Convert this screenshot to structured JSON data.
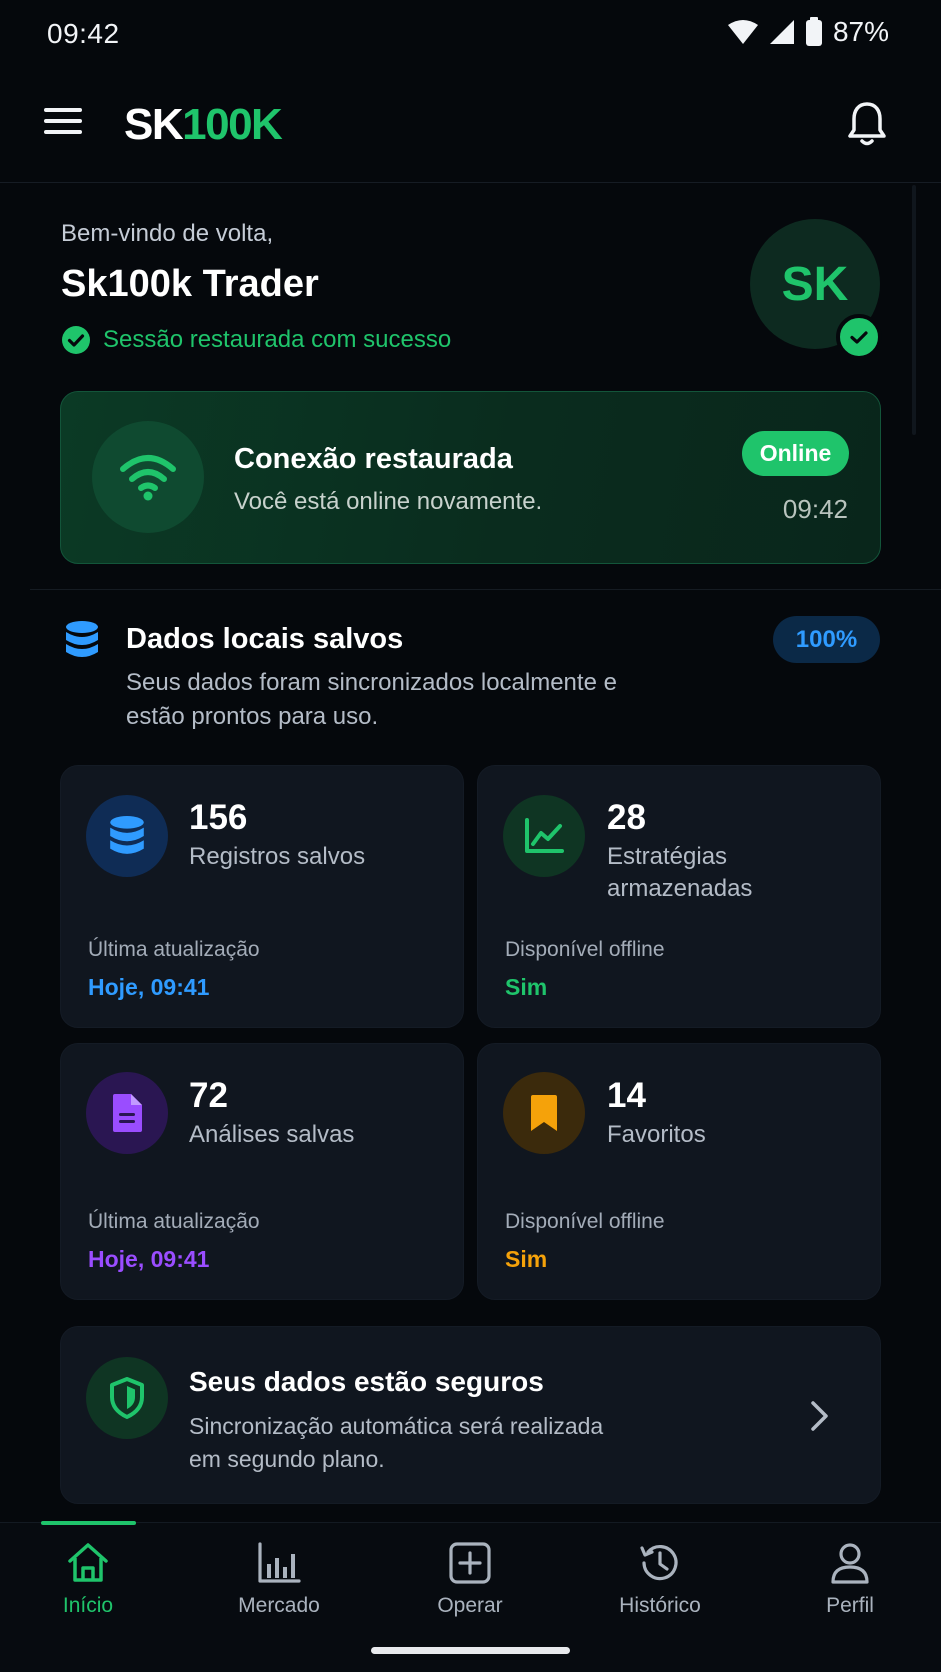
{
  "status_bar": {
    "time": "09:42",
    "battery": "87%"
  },
  "app_bar": {
    "logo_part1": "SK",
    "logo_part2": "100K"
  },
  "welcome": {
    "greeting": "Bem-vindo de volta,",
    "name": "Sk100k Trader",
    "session_status": "Sessão restaurada com sucesso",
    "avatar_initials": "SK"
  },
  "connection": {
    "title": "Conexão restaurada",
    "subtitle": "Você está online novamente.",
    "badge": "Online",
    "time": "09:42"
  },
  "local_data": {
    "title": "Dados locais salvos",
    "description": "Seus dados foram sincronizados localmente e estão prontos para uso.",
    "percent": "100%"
  },
  "stats": [
    {
      "value": "156",
      "label": "Registros salvos",
      "foot_label": "Última atualização",
      "foot_value": "Hoje, 09:41",
      "icon": "database-icon",
      "accent": "#2f9bff"
    },
    {
      "value": "28",
      "label": "Estratégias armazenadas",
      "foot_label": "Disponível offline",
      "foot_value": "Sim",
      "icon": "chart-line-icon",
      "accent": "#1fc46b"
    },
    {
      "value": "72",
      "label": "Análises salvas",
      "foot_label": "Última atualização",
      "foot_value": "Hoje, 09:41",
      "icon": "document-icon",
      "accent": "#9a4dff"
    },
    {
      "value": "14",
      "label": "Favoritos",
      "foot_label": "Disponível offline",
      "foot_value": "Sim",
      "icon": "bookmark-icon",
      "accent": "#f5a20a"
    }
  ],
  "secure": {
    "title": "Seus dados estão seguros",
    "description": "Sincronização automática será realizada em segundo plano."
  },
  "bottom_nav": [
    {
      "label": "Início",
      "icon": "home-icon",
      "active": true
    },
    {
      "label": "Mercado",
      "icon": "market-chart-icon",
      "active": false
    },
    {
      "label": "Operar",
      "icon": "plus-square-icon",
      "active": false
    },
    {
      "label": "Histórico",
      "icon": "history-clock-icon",
      "active": false
    },
    {
      "label": "Perfil",
      "icon": "profile-icon",
      "active": false
    }
  ],
  "colors": {
    "background": "#05080c",
    "accent_green": "#1fc46b",
    "accent_blue": "#2f9bff",
    "accent_purple": "#9a4dff",
    "accent_orange": "#f5a20a",
    "card": "#10161f"
  }
}
